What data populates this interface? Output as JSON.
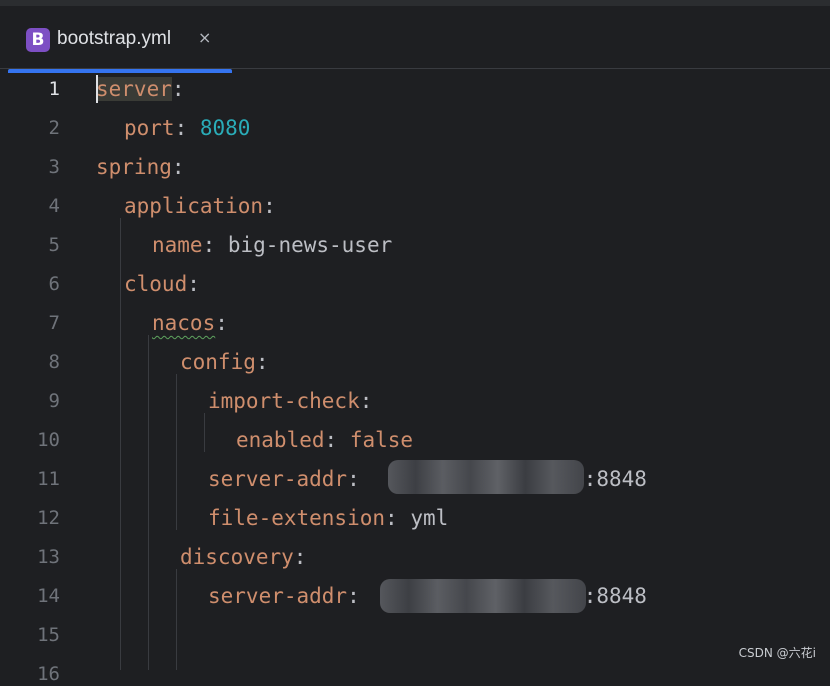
{
  "tab": {
    "icon_letter": "B",
    "title": "bootstrap.yml",
    "close_glyph": "×"
  },
  "gutter": {
    "line_numbers": [
      "1",
      "2",
      "3",
      "4",
      "5",
      "6",
      "7",
      "8",
      "9",
      "10",
      "11",
      "12",
      "13",
      "14",
      "15",
      "16"
    ]
  },
  "code": {
    "l1": {
      "key": "server",
      "punct": ":"
    },
    "l2": {
      "key": "port",
      "punct": ": ",
      "value": "8080"
    },
    "l3": {
      "key": "spring",
      "punct": ":"
    },
    "l4": {
      "key": "application",
      "punct": ":"
    },
    "l5": {
      "key": "name",
      "punct": ": ",
      "value": "big-news-user"
    },
    "l6": {
      "key": "cloud",
      "punct": ":"
    },
    "l7": {
      "key": "nacos",
      "punct": ":"
    },
    "l8": {
      "key": "config",
      "punct": ":"
    },
    "l9": {
      "key": "import-check",
      "punct": ":"
    },
    "l10": {
      "key": "enabled",
      "punct": ": ",
      "value": "false"
    },
    "l11": {
      "key": "server-addr",
      "punct": ":",
      "value": ":8848"
    },
    "l12": {
      "key": "file-extension",
      "punct": ": ",
      "value": "yml"
    },
    "l13": {
      "key": "discovery",
      "punct": ":"
    },
    "l14": {
      "key": "server-addr",
      "punct": ":",
      "value": ":8848"
    }
  },
  "watermark": "CSDN @六花i",
  "icons": {
    "file_type": "bootstrap-file-icon",
    "close": "close-icon"
  },
  "colors": {
    "background": "#1e1f22",
    "key": "#cf8e6d",
    "number": "#2aacb8",
    "text": "#bcbec4",
    "tab_accent": "#3574f0",
    "icon_bg": "#7d4fc4"
  }
}
